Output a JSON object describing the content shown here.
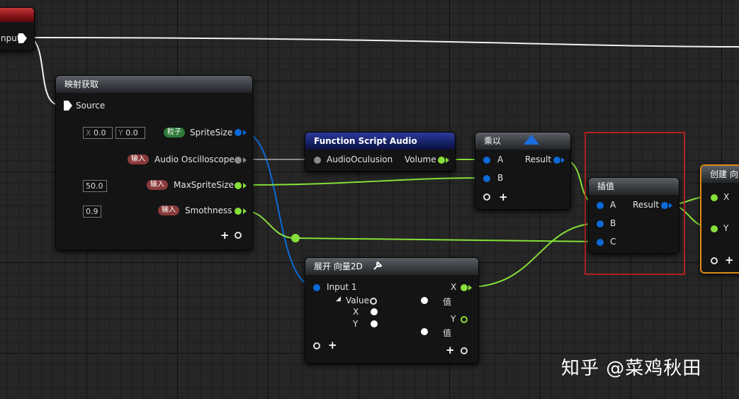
{
  "colors": {
    "exec": "#ffffff",
    "float_pin": "#0b6ad8",
    "vector_pin": "#86e03a",
    "highlight": "#e02020",
    "selection": "#e08a1a"
  },
  "input_node": {
    "output_label": "nput"
  },
  "map_node": {
    "title": "映射获取",
    "source_label": "Source",
    "x_label": "X",
    "x_value": "0.0",
    "y_label": "Y",
    "y_value": "0.0",
    "sprite_badge": "粒子",
    "sprite_label": "SpriteSize",
    "audio_badge": "输入",
    "audio_label": "Audio Oscilloscope",
    "max_value": "50.0",
    "max_badge": "输入",
    "max_label": "MaxSpriteSize",
    "smooth_value": "0.9",
    "smooth_badge": "输入",
    "smooth_label": "Smothness"
  },
  "fn_node": {
    "title": "Function Script Audio",
    "input_label": "AudioOculusion",
    "output_label": "Volume"
  },
  "multiply_node": {
    "title": "乘以",
    "a_label": "A",
    "b_label": "B",
    "result_label": "Result"
  },
  "lerp_node": {
    "title": "插值",
    "a_label": "A",
    "b_label": "B",
    "c_label": "C",
    "result_label": "Result"
  },
  "make_node": {
    "title": "创建 向",
    "x_label": "X",
    "y_label": "Y"
  },
  "break_node": {
    "title": "展开 向量2D",
    "input_label": "Input 1",
    "value_label": "Value",
    "x_in": "X",
    "y_in": "Y",
    "x_out": "X",
    "y_out": "Y",
    "val1": "值",
    "val2": "值"
  },
  "watermark": "知乎 @菜鸡秋田"
}
